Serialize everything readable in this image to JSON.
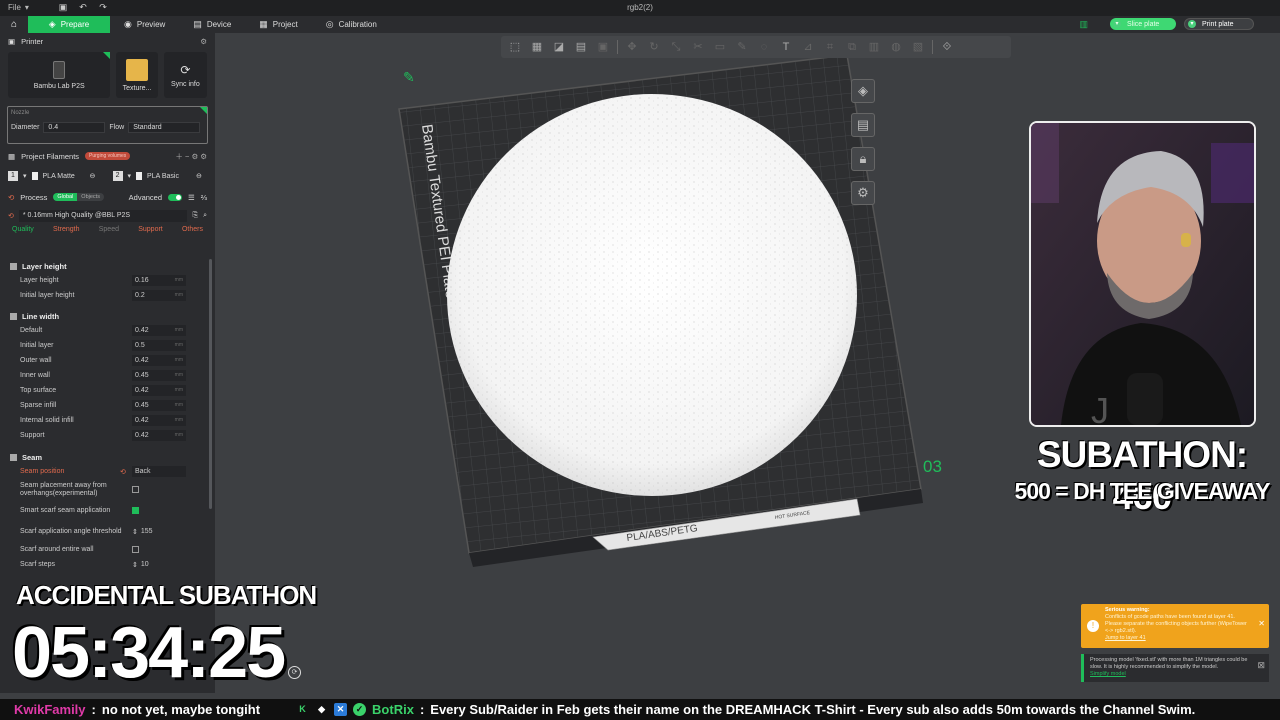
{
  "titlebar": {
    "file_label": "File",
    "doc_title": "rgb2(2)"
  },
  "nav": {
    "tabs": [
      {
        "label": "Prepare",
        "icon": "cube-icon"
      },
      {
        "label": "Preview",
        "icon": "eye-icon"
      },
      {
        "label": "Device",
        "icon": "device-icon"
      },
      {
        "label": "Project",
        "icon": "project-icon"
      },
      {
        "label": "Calibration",
        "icon": "calibration-icon"
      }
    ],
    "slice_label": "Slice plate",
    "print_label": "Print plate"
  },
  "printer": {
    "section_title": "Printer",
    "printer_name": "Bambu Lab P2S",
    "plate_name": "Texture...",
    "sync_label": "Sync info",
    "nozzle_title": "Nozzle",
    "diameter_label": "Diameter",
    "diameter_value": "0.4",
    "flow_label": "Flow",
    "flow_value": "Standard"
  },
  "filaments": {
    "section_title": "Project Filaments",
    "purge_badge": "Purging volumes",
    "items": [
      {
        "num": "1",
        "name": "PLA Matte"
      },
      {
        "num": "2",
        "name": "PLA Basic"
      }
    ]
  },
  "process": {
    "section_title": "Process",
    "toggle_global": "Global",
    "toggle_objects": "Objects",
    "advanced_label": "Advanced",
    "preset": "* 0.16mm High Quality @BBL P2S",
    "tabs": [
      "Quality",
      "Strength",
      "Speed",
      "Support",
      "Others"
    ]
  },
  "params": {
    "layer_height_title": "Layer height",
    "layer_height": {
      "label": "Layer height",
      "value": "0.16",
      "unit": "mm"
    },
    "initial_layer_height": {
      "label": "Initial layer height",
      "value": "0.2",
      "unit": "mm"
    },
    "line_width_title": "Line width",
    "line_widths": [
      {
        "label": "Default",
        "value": "0.42",
        "unit": "mm"
      },
      {
        "label": "Initial layer",
        "value": "0.5",
        "unit": "mm"
      },
      {
        "label": "Outer wall",
        "value": "0.42",
        "unit": "mm"
      },
      {
        "label": "Inner wall",
        "value": "0.45",
        "unit": "mm"
      },
      {
        "label": "Top surface",
        "value": "0.42",
        "unit": "mm"
      },
      {
        "label": "Sparse infill",
        "value": "0.45",
        "unit": "mm"
      },
      {
        "label": "Internal solid infill",
        "value": "0.42",
        "unit": "mm"
      },
      {
        "label": "Support",
        "value": "0.42",
        "unit": "mm"
      }
    ],
    "seam_title": "Seam",
    "seam_position": {
      "label": "Seam position",
      "value": "Back"
    },
    "seam_away": "Seam placement away from overhangs(experimental)",
    "smart_scarf": "Smart scarf seam application",
    "scarf_angle": {
      "label": "Scarf application angle threshold",
      "value": "155"
    },
    "scarf_entire": "Scarf around entire wall",
    "scarf_steps": {
      "label": "Scarf steps",
      "value": "10"
    }
  },
  "viewport": {
    "plate_brand": "Bambu Textured PEI Plate",
    "plate_materials": "PLA/ABS/PETG",
    "plate_hot": "HOT SURFACE",
    "plate_number": "03"
  },
  "stream": {
    "subathon_count": "SUBATHON: 460",
    "subathon_goal": "500 = DH TEE GIVEAWAY",
    "timer_title": "ACCIDENTAL SUBATHON",
    "timer": "05:34:25"
  },
  "notifications": {
    "warning_title": "Serious warning:",
    "warning_text": "Conflicts of gcode paths have been found at layer 41. Please separate the conflicting objects further (WipeTower <-> rgb2.stl).",
    "warning_link": "Jump to layer 41",
    "info_text": "Processing model 'fixed.stl' with more than 1M triangles could be slow. It is highly recommended to simplify the model.",
    "info_link": "Simplify model"
  },
  "ticker": {
    "user1": "KwikFamily",
    "msg1": "no not yet, maybe tongiht",
    "user2": "BotRix",
    "msg2": "Every Sub/Raider in Feb gets their name on the DREAMHACK T-Shirt - Every sub also adds 50m towards the Channel Swim."
  }
}
